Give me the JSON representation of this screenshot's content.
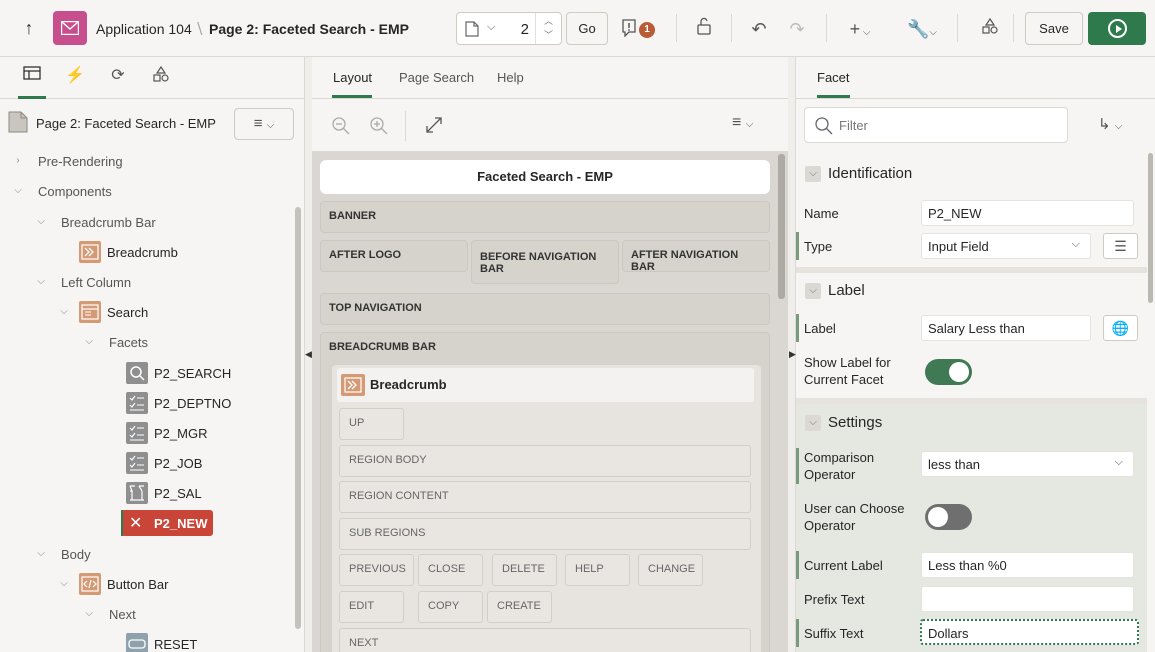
{
  "toolbar": {
    "app_name": "Application 104",
    "page_name": "Page 2: Faceted Search - EMP",
    "page_number": "2",
    "go_label": "Go",
    "warning_count": "1",
    "save_label": "Save"
  },
  "left": {
    "header_title": "Page 2: Faceted Search - EMP",
    "tree": [
      {
        "label": "Pre-Rendering"
      },
      {
        "label": "Components"
      },
      {
        "label": "Breadcrumb Bar"
      },
      {
        "label": "Breadcrumb"
      },
      {
        "label": "Left Column"
      },
      {
        "label": "Search"
      },
      {
        "label": "Facets"
      },
      {
        "label": "P2_SEARCH"
      },
      {
        "label": "P2_DEPTNO"
      },
      {
        "label": "P2_MGR"
      },
      {
        "label": "P2_JOB"
      },
      {
        "label": "P2_SAL"
      },
      {
        "label": "P2_NEW"
      },
      {
        "label": "Body"
      },
      {
        "label": "Button Bar"
      },
      {
        "label": "Next"
      },
      {
        "label": "RESET"
      }
    ]
  },
  "middle": {
    "tabs": [
      "Layout",
      "Page Search",
      "Help"
    ],
    "page_title": "Faceted Search - EMP",
    "slots": {
      "banner": "BANNER",
      "after_logo": "AFTER LOGO",
      "before_nav": "BEFORE NAVIGATION BAR",
      "after_nav": "AFTER NAVIGATION BAR",
      "top_nav": "TOP NAVIGATION",
      "breadcrumb_bar": "BREADCRUMB BAR"
    },
    "region_title": "Breadcrumb",
    "positions": [
      "UP",
      "REGION BODY",
      "REGION CONTENT",
      "SUB REGIONS",
      "PREVIOUS",
      "CLOSE",
      "DELETE",
      "HELP",
      "CHANGE",
      "EDIT",
      "COPY",
      "CREATE",
      "NEXT"
    ]
  },
  "right": {
    "tab": "Facet",
    "filter_placeholder": "Filter",
    "sections": {
      "identification": "Identification",
      "label": "Label",
      "settings": "Settings"
    },
    "props": {
      "name_label": "Name",
      "name_value": "P2_NEW",
      "type_label": "Type",
      "type_value": "Input Field",
      "label_label": "Label",
      "label_value": "Salary Less than",
      "show_label_label": "Show Label for Current Facet",
      "show_label_value": true,
      "comparison_label": "Comparison Operator",
      "comparison_value": "less than",
      "user_choose_label": "User can Choose Operator",
      "user_choose_value": false,
      "current_label_label": "Current Label",
      "current_label_value": "Less than %0",
      "prefix_label": "Prefix Text",
      "prefix_value": "",
      "suffix_label": "Suffix Text",
      "suffix_value": "Dollars"
    }
  },
  "colors": {
    "accent": "#2e7a4c",
    "app_icon": "#c74f8d",
    "selected": "#c84537",
    "badge": "#b95b36"
  }
}
